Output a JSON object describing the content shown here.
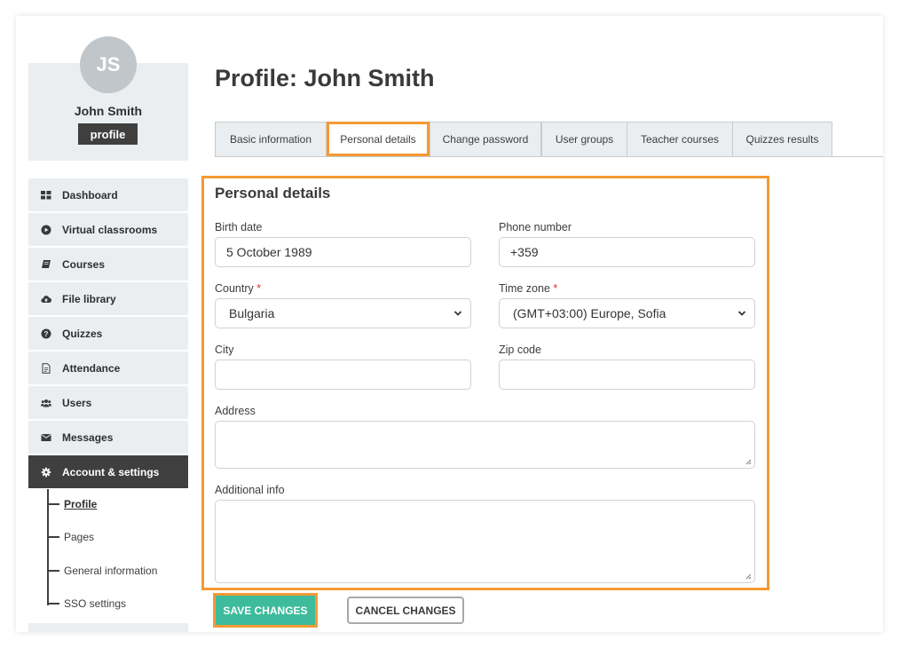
{
  "user": {
    "initials": "JS",
    "name": "John Smith",
    "badge": "profile"
  },
  "sidebar": {
    "items": [
      {
        "label": "Dashboard",
        "icon": "dashboard-icon"
      },
      {
        "label": "Virtual classrooms",
        "icon": "play-circle-icon"
      },
      {
        "label": "Courses",
        "icon": "book-icon"
      },
      {
        "label": "File library",
        "icon": "cloud-upload-icon"
      },
      {
        "label": "Quizzes",
        "icon": "question-circle-icon"
      },
      {
        "label": "Attendance",
        "icon": "document-icon"
      },
      {
        "label": "Users",
        "icon": "users-icon"
      },
      {
        "label": "Messages",
        "icon": "envelope-icon"
      },
      {
        "label": "Account & settings",
        "icon": "gear-icon",
        "active": true
      }
    ],
    "subitems": [
      {
        "label": "Profile",
        "active": true
      },
      {
        "label": "Pages"
      },
      {
        "label": "General information"
      },
      {
        "label": "SSO settings"
      }
    ]
  },
  "page": {
    "title": "Profile: John Smith"
  },
  "tabs": [
    {
      "label": "Basic information"
    },
    {
      "label": "Personal details",
      "active": true
    },
    {
      "label": "Change password"
    },
    {
      "label": "User groups"
    },
    {
      "label": "Teacher courses"
    },
    {
      "label": "Quizzes results"
    }
  ],
  "form": {
    "title": "Personal details",
    "birth_date": {
      "label": "Birth date",
      "value": "5 October 1989"
    },
    "phone": {
      "label": "Phone number",
      "value": "+359"
    },
    "country": {
      "label": "Country",
      "required_mark": "*",
      "value": "Bulgaria"
    },
    "timezone": {
      "label": "Time zone",
      "required_mark": "*",
      "value": "(GMT+03:00) Europe, Sofia"
    },
    "city": {
      "label": "City",
      "value": ""
    },
    "zip": {
      "label": "Zip code",
      "value": ""
    },
    "address": {
      "label": "Address",
      "value": ""
    },
    "additional": {
      "label": "Additional info",
      "value": ""
    }
  },
  "actions": {
    "save": "SAVE CHANGES",
    "cancel": "CANCEL CHANGES"
  },
  "colors": {
    "highlight": "#f59a33",
    "save_button": "#3dbb9c",
    "sidebar_bg": "#ebeef0",
    "active_nav": "#3f3f3f",
    "required": "#e0303a"
  }
}
